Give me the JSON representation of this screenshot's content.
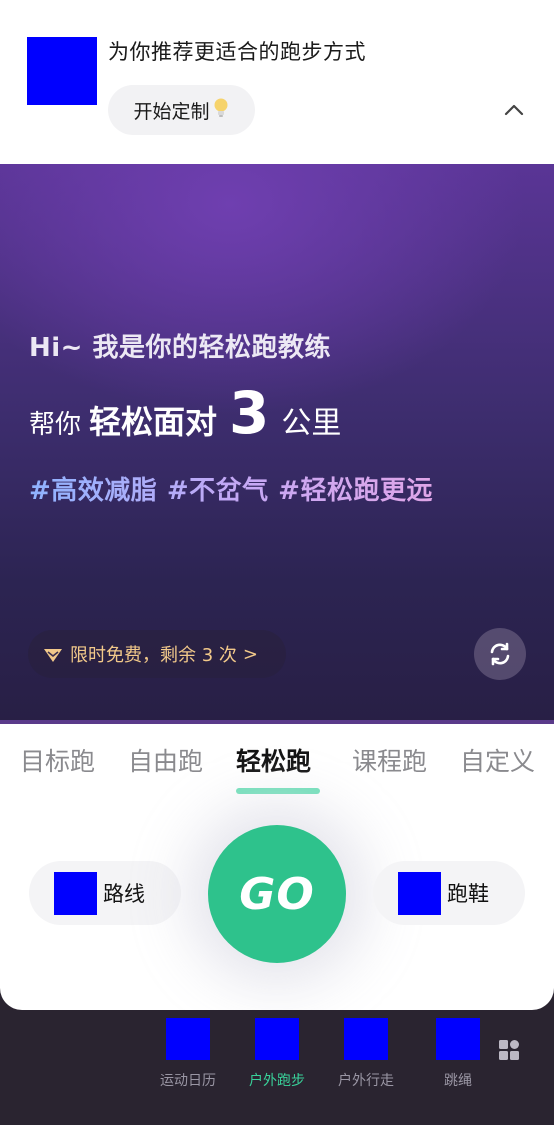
{
  "top": {
    "title": "为你推荐更适合的跑步方式",
    "start_button": "开始定制",
    "bulb_icon": "lightbulb-icon"
  },
  "hero": {
    "line1": "Hi~ 我是你的轻松跑教练",
    "line2_prefix": "帮你",
    "line2_emph": "轻松面对",
    "line2_number": "3",
    "line2_suffix": "公里",
    "tags": "#高效减脂 #不岔气 #轻松跑更远",
    "offer": "限时免费，剩余 3 次",
    "offer_chevron": ">"
  },
  "tabs": [
    "目标跑",
    "自由跑",
    "轻松跑",
    "课程跑",
    "自定义"
  ],
  "active_tab": "轻松跑",
  "actions": {
    "route_label": "路线",
    "shoes_label": "跑鞋",
    "go_label": "GO"
  },
  "nav": [
    {
      "label": "运动日历",
      "active": false
    },
    {
      "label": "户外跑步",
      "active": true
    },
    {
      "label": "户外行走",
      "active": false
    },
    {
      "label": "跳绳",
      "active": false
    }
  ],
  "colors": {
    "accent_green": "#2ec28c",
    "active_nav": "#39d29a",
    "offer_gold": "#f2c98a",
    "placeholder_blue": "#0000ff"
  }
}
